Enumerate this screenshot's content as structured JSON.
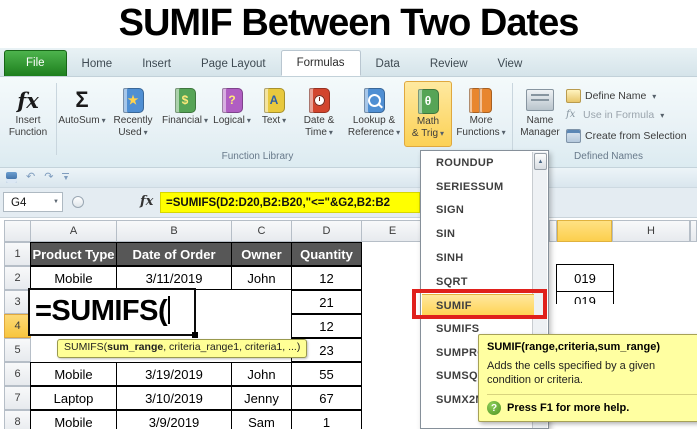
{
  "title": "SUMIF Between Two Dates",
  "ui": {
    "dropdown_arrow": "▾",
    "scroll_up_arrow": "▲",
    "name_box_arrow": "▼",
    "undo": "↶",
    "redo": "↷",
    "customize": "▼",
    "question_mark": "?",
    "fx_label": "fx"
  },
  "tabs": {
    "items": [
      "File",
      "Home",
      "Insert",
      "Page Layout",
      "Formulas",
      "Data",
      "Review",
      "View"
    ],
    "active": "Formulas"
  },
  "ribbon": {
    "function_library": {
      "label": "Function Library",
      "buttons": [
        {
          "name": "insert-function",
          "lines": [
            "Insert",
            "Function"
          ],
          "arrow": false,
          "icon": {
            "kind": "fx"
          }
        },
        {
          "name": "autosum",
          "lines": [
            "AutoSum"
          ],
          "arrow": true,
          "icon": {
            "kind": "sigma"
          }
        },
        {
          "name": "recently-used",
          "lines": [
            "Recently",
            "Used"
          ],
          "arrow": true,
          "icon": {
            "kind": "book",
            "color": "#4f8fd3",
            "glyph": "★",
            "glyphColor": "#ffd34d"
          }
        },
        {
          "name": "financial",
          "lines": [
            "Financial"
          ],
          "arrow": true,
          "icon": {
            "kind": "book",
            "color": "#56a456",
            "glyph": "$",
            "glyphColor": "#ffe97a"
          }
        },
        {
          "name": "logical",
          "lines": [
            "Logical"
          ],
          "arrow": true,
          "icon": {
            "kind": "book",
            "color": "#b05ec2",
            "glyph": "?",
            "glyphColor": "#ffe97a"
          }
        },
        {
          "name": "text",
          "lines": [
            "Text"
          ],
          "arrow": true,
          "icon": {
            "kind": "book",
            "color": "#e8c93e",
            "glyph": "A",
            "glyphColor": "#2c5fa8"
          }
        },
        {
          "name": "date-time",
          "lines": [
            "Date &",
            "Time"
          ],
          "arrow": true,
          "icon": {
            "kind": "book",
            "color": "#d2452e",
            "glyph": "clock"
          }
        },
        {
          "name": "lookup-reference",
          "lines": [
            "Lookup &",
            "Reference"
          ],
          "arrow": true,
          "icon": {
            "kind": "book",
            "color": "#4f8fd3",
            "glyph": "lens"
          }
        },
        {
          "name": "math-trig",
          "lines": [
            "Math",
            "& Trig"
          ],
          "arrow": true,
          "highlighted": true,
          "icon": {
            "kind": "book",
            "color": "#56a456",
            "glyph": "θ",
            "glyphColor": "#ffffff"
          }
        },
        {
          "name": "more-functions",
          "lines": [
            "More",
            "Functions"
          ],
          "arrow": true,
          "icon": {
            "kind": "books",
            "color": "#e8862e"
          }
        }
      ]
    },
    "defined_names": {
      "label": "Defined Names",
      "name_manager_lines": [
        "Name",
        "Manager"
      ],
      "items": [
        {
          "label": "Define Name",
          "arrow": true,
          "disabled": false,
          "icon": "tag"
        },
        {
          "label": "Use in Formula",
          "arrow": true,
          "disabled": true,
          "icon": "fxs"
        },
        {
          "label": "Create from Selection",
          "arrow": false,
          "disabled": false,
          "icon": "grid"
        }
      ]
    }
  },
  "formula_bar": {
    "name_box": "G4",
    "formula": "=SUMIFS(D2:D20,B2:B20,\"<=\"&G2,B2:B2"
  },
  "menu": {
    "items": [
      "ROUNDUP",
      "SERIESSUM",
      "SIGN",
      "SIN",
      "SINH",
      "SQRT",
      "SUMIF",
      "SUMIFS",
      "SUMPRO",
      "SUMSQ",
      "SUMX2M"
    ],
    "highlighted": "SUMIF"
  },
  "cell_editor": {
    "text": "=SUMIFS("
  },
  "hint_tooltip": {
    "pre": "SUMIFS(",
    "bold": "sum_range",
    "post": ", criteria_range1, criteria1, ...)"
  },
  "help_tooltip": {
    "title": "SUMIF(range,criteria,sum_range)",
    "body": "Adds the cells specified by a given condition or criteria.",
    "footer": "Press F1 for more help."
  },
  "sheet": {
    "col_headers_left": [
      "A",
      "B",
      "C",
      "D",
      "E"
    ],
    "col_header_selected": "",
    "col_header_h": "H",
    "row_headers": [
      "1",
      "2",
      "3",
      "4",
      "5",
      "6",
      "7",
      "8"
    ],
    "selected_row": "4",
    "table_header": [
      "Product Type",
      "Date of Order",
      "Owner",
      "Quantity"
    ],
    "rows": [
      [
        "Mobile",
        "3/11/2019",
        "John",
        "12"
      ],
      [
        null,
        null,
        null,
        "21"
      ],
      [
        null,
        null,
        null,
        "12"
      ],
      [
        null,
        null,
        null,
        "23"
      ],
      [
        "Mobile",
        "3/19/2019",
        "John",
        "55"
      ],
      [
        "Laptop",
        "3/10/2019",
        "Jenny",
        "67"
      ],
      [
        "Mobile",
        "3/9/2019",
        "Sam",
        "1"
      ]
    ],
    "g_cells": [
      "019",
      "019"
    ]
  },
  "colors": {
    "file_tab_green": "#2f9d2f",
    "highlight_orange": "#fcd155",
    "formula_highlight": "#ffff00",
    "table_header_gray": "#575757",
    "tooltip_yellow": "#ffffa1",
    "red_box": "#e0201c",
    "selected_header_yellow": "#fccf4d"
  }
}
